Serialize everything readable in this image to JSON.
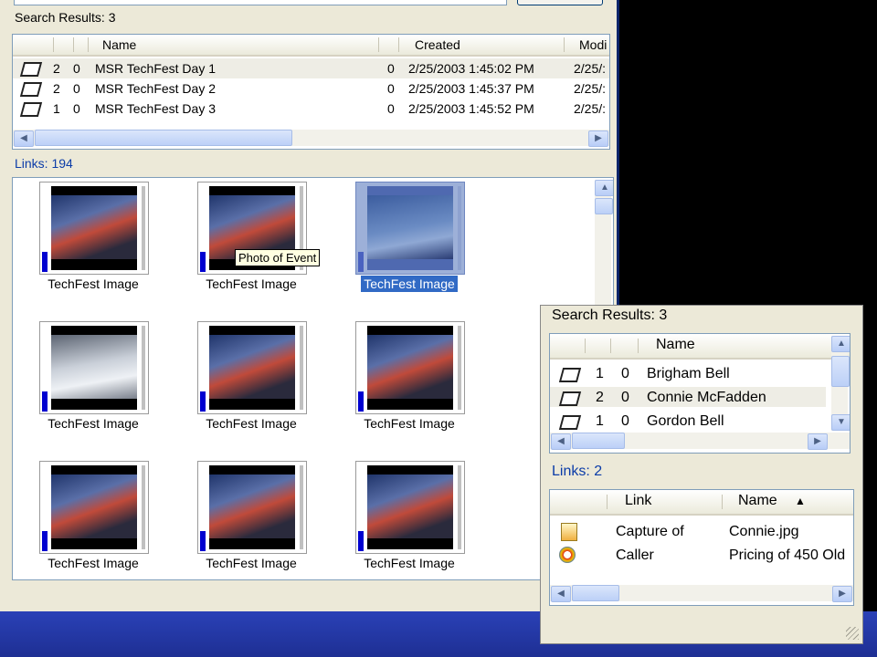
{
  "main": {
    "search_results_label": "Search Results: 3",
    "columns": [
      "Name",
      "Created",
      "Modi"
    ],
    "rows": [
      {
        "a": "2",
        "b": "0",
        "name": "MSR TechFest Day 1",
        "c": "0",
        "created": "2/25/2003 1:45:02 PM",
        "modified": "2/25/:"
      },
      {
        "a": "2",
        "b": "0",
        "name": "MSR TechFest Day 2",
        "c": "0",
        "created": "2/25/2003 1:45:37 PM",
        "modified": "2/25/:"
      },
      {
        "a": "1",
        "b": "0",
        "name": "MSR TechFest Day 3",
        "c": "0",
        "created": "2/25/2003 1:45:52 PM",
        "modified": "2/25/:"
      }
    ],
    "links_label": "Links:  194",
    "images": [
      {
        "caption": "TechFest Image"
      },
      {
        "caption": "TechFest Image"
      },
      {
        "caption": "TechFest Image"
      },
      {
        "caption": "TechFest Image"
      },
      {
        "caption": "TechFest Image"
      },
      {
        "caption": "TechFest Image"
      },
      {
        "caption": "TechFest Image"
      },
      {
        "caption": "TechFest Image"
      },
      {
        "caption": "TechFest Image"
      }
    ],
    "tooltip": "Photo of Event",
    "selected_image_index": 2
  },
  "inset": {
    "search_results_label": "Search Results: 3",
    "columns": [
      "Name"
    ],
    "rows": [
      {
        "a": "1",
        "b": "0",
        "name": "Brigham Bell"
      },
      {
        "a": "2",
        "b": "0",
        "name": "Connie McFadden"
      },
      {
        "a": "1",
        "b": "0",
        "name": "Gordon Bell"
      }
    ],
    "links_label": "Links:  2",
    "link_columns": [
      "Link",
      "Name"
    ],
    "link_rows": [
      {
        "link": "Capture of",
        "name": "Connie.jpg"
      },
      {
        "link": "Caller",
        "name": "Pricing of 450 Old"
      }
    ]
  },
  "icons": {
    "folder": "folder-icon",
    "sort": "sort-ascending-icon",
    "image_file": "image-file-icon",
    "web_link": "web-link-icon"
  }
}
